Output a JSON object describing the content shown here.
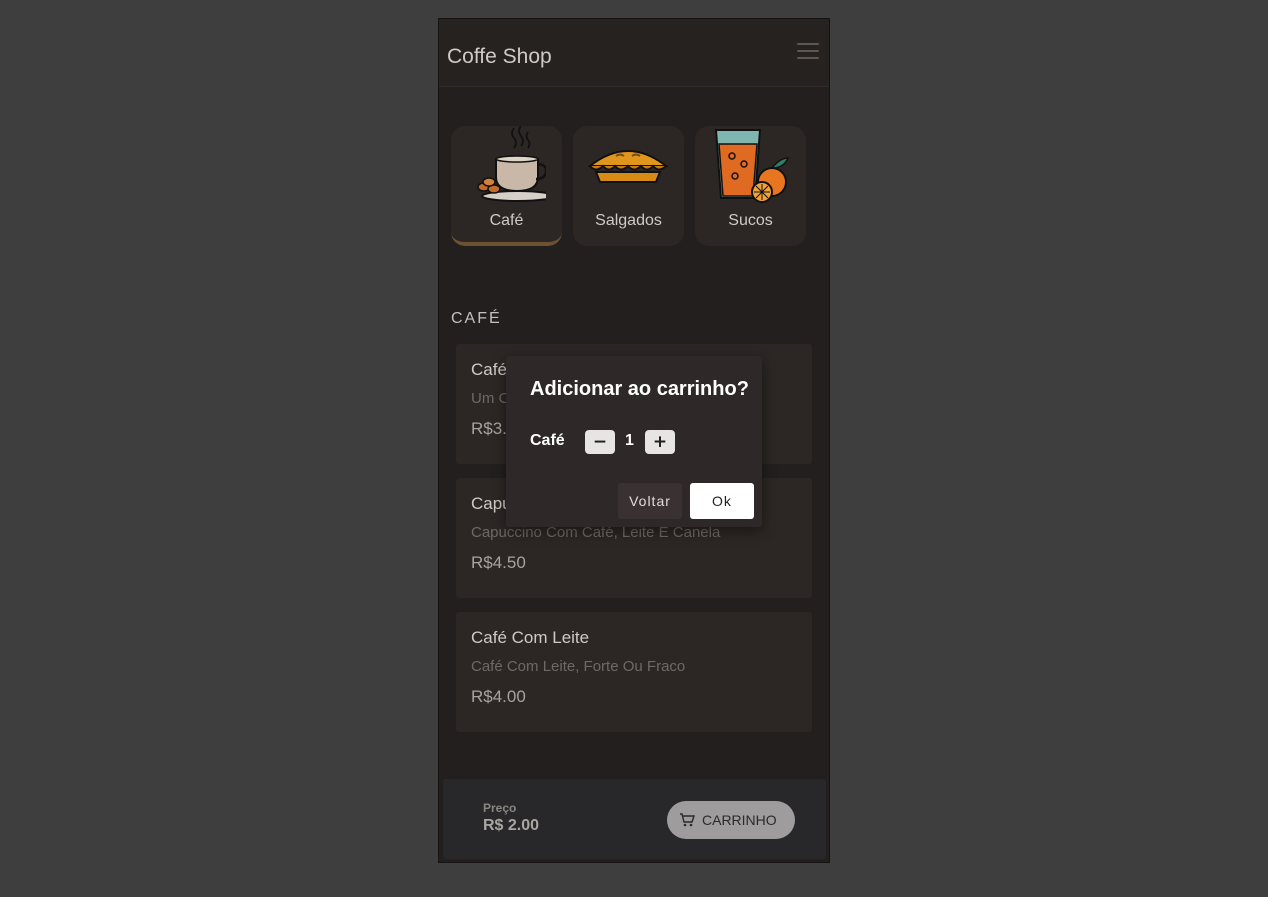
{
  "app": {
    "title": "Coffe Shop",
    "menu_icon": "hamburger-menu-icon"
  },
  "categories": [
    {
      "label": "Café",
      "icon": "coffee-cup-icon",
      "active": true
    },
    {
      "label": "Salgados",
      "icon": "pie-icon",
      "active": false
    },
    {
      "label": "Sucos",
      "icon": "orange-juice-icon",
      "active": false
    }
  ],
  "section": {
    "title": "CAFÉ"
  },
  "products": [
    {
      "name": "Café",
      "description": "Um C",
      "price": "R$3."
    },
    {
      "name": "Capu",
      "description": "Capuccino Com Café, Leite E Canela",
      "price": "R$4.50"
    },
    {
      "name": "Café Com Leite",
      "description": "Café Com Leite, Forte Ou Fraco",
      "price": "R$4.00"
    }
  ],
  "bottom_bar": {
    "price_label": "Preço",
    "price_value": "R$ 2.00",
    "cart_label": "CARRINHO",
    "cart_icon": "shopping-cart-icon"
  },
  "dialog": {
    "title": "Adicionar ao carrinho?",
    "item_name": "Café",
    "quantity": "1",
    "minus_label": "−",
    "plus_label": "+",
    "back_label": "Voltar",
    "ok_label": "Ok"
  },
  "colors": {
    "background": "#3e3e3e",
    "surface": "#221f1e",
    "card": "#2c2725",
    "active_accent": "#6d5232",
    "dialog": "#2e2928"
  }
}
